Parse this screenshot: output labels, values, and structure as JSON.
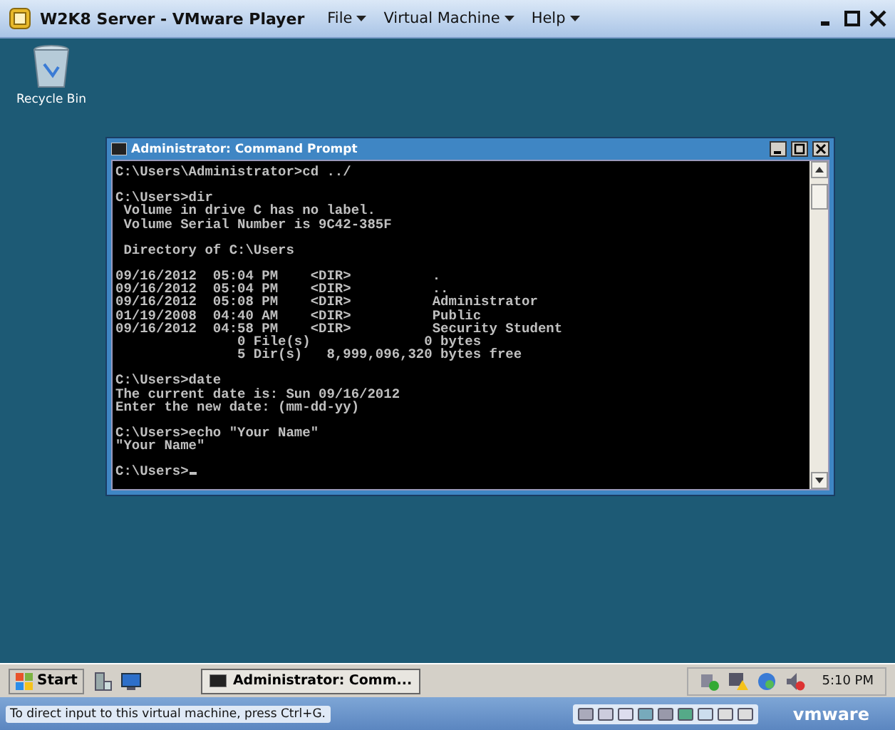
{
  "window": {
    "title": "W2K8 Server - VMware Player",
    "menu": [
      "File",
      "Virtual Machine",
      "Help"
    ]
  },
  "desktop": {
    "icons": [
      {
        "label": "Recycle Bin"
      }
    ]
  },
  "console": {
    "title": "Administrator: Command Prompt",
    "blocks": [
      [
        "C:\\Users\\Administrator>cd ../"
      ],
      [
        "C:\\Users>dir",
        " Volume in drive C has no label.",
        " Volume Serial Number is 9C42-385F"
      ],
      [
        " Directory of C:\\Users"
      ],
      [
        "09/16/2012  05:04 PM    <DIR>          .",
        "09/16/2012  05:04 PM    <DIR>          ..",
        "09/16/2012  05:08 PM    <DIR>          Administrator",
        "01/19/2008  04:40 AM    <DIR>          Public",
        "09/16/2012  04:58 PM    <DIR>          Security Student",
        "               0 File(s)              0 bytes",
        "               5 Dir(s)   8,999,096,320 bytes free"
      ],
      [
        "C:\\Users>date",
        "The current date is: Sun 09/16/2012",
        "Enter the new date: (mm-dd-yy)"
      ],
      [
        "C:\\Users>echo \"Your Name\"",
        "\"Your Name\""
      ],
      [
        "C:\\Users>"
      ]
    ]
  },
  "taskbar": {
    "start": "Start",
    "tasks": [
      {
        "label": "Administrator: Comm...",
        "selected": true
      }
    ],
    "clock": "5:10 PM"
  },
  "status_bar": {
    "text": "To direct input to this virtual machine, press Ctrl+G.",
    "logo": "vmware"
  }
}
